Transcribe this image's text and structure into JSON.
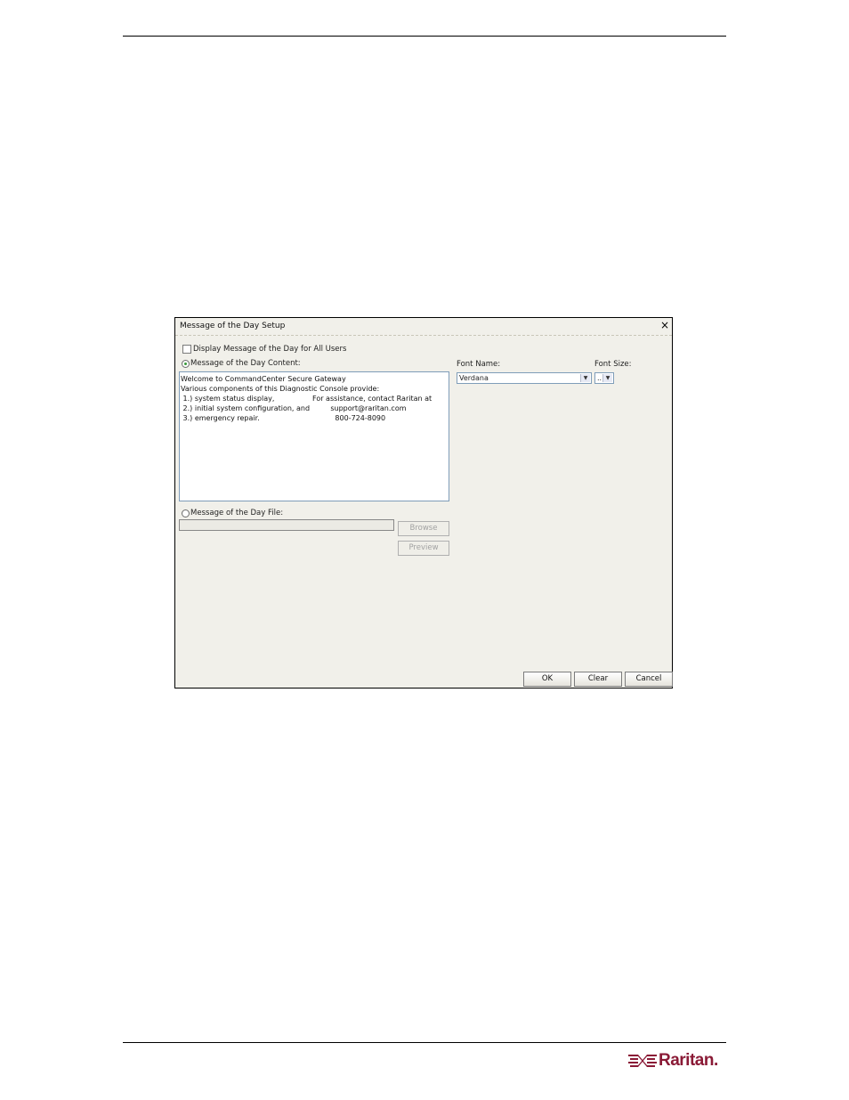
{
  "dialog": {
    "title": "Message of the Day Setup",
    "close_glyph": "×",
    "display_checkbox_label": "Display Message of the Day for All Users",
    "display_checked": false,
    "content_option_label": "Message of the Day Content:",
    "content_option_selected": true,
    "message_lines": [
      {
        "left": "Welcome to CommandCenter Secure Gateway",
        "right": ""
      },
      {
        "left": "Various components of this Diagnostic Console provide:",
        "right": ""
      },
      {
        "left": " 1.) system status display,",
        "right": "For assistance, contact Raritan at"
      },
      {
        "left": " 2.) initial system configuration, and",
        "right": "        support@raritan.com"
      },
      {
        "left": " 3.) emergency repair.",
        "right": "          800-724-8090"
      }
    ],
    "font_name_label": "Font Name:",
    "font_name_value": "Verdana",
    "font_size_label": "Font Size:",
    "font_size_value": "..",
    "file_option_label": "Message of the Day File:",
    "file_option_selected": false,
    "file_path_value": "",
    "browse_label": "Browse",
    "preview_label": "Preview",
    "ok_label": "OK",
    "clear_label": "Clear",
    "cancel_label": "Cancel"
  },
  "icons": {
    "select_arrow": "chevron-down-icon",
    "close": "close-icon",
    "logo": "raritan-logo"
  },
  "brand": {
    "name": "Raritan.",
    "color": "#8a1a36"
  }
}
